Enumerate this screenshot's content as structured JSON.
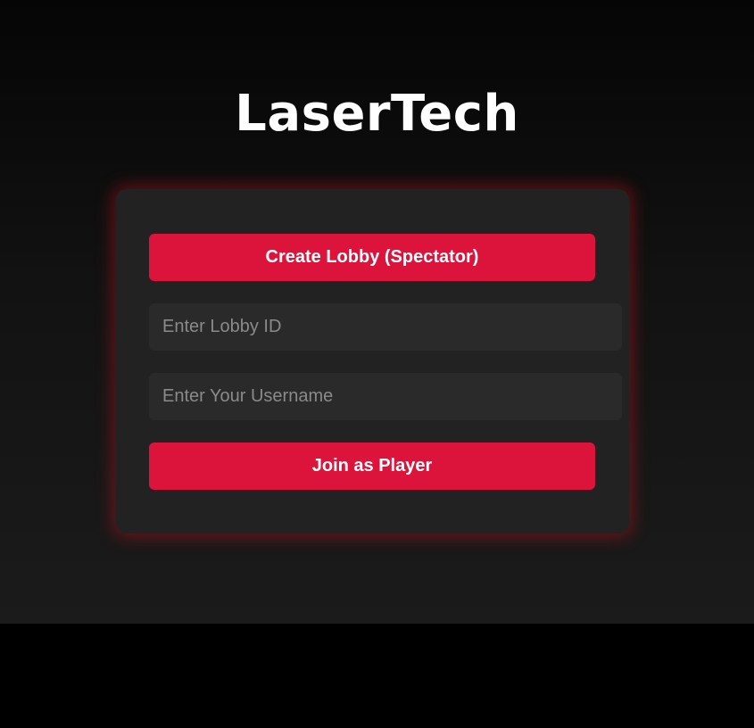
{
  "app": {
    "title": "LaserTech"
  },
  "lobby_form": {
    "create_button_label": "Create Lobby (Spectator)",
    "lobby_id_placeholder": "Enter Lobby ID",
    "lobby_id_value": "",
    "username_placeholder": "Enter Your Username",
    "username_value": "",
    "join_button_label": "Join as Player"
  },
  "colors": {
    "accent": "#dc143c",
    "card_background": "#222222",
    "input_background": "#2a2a2a",
    "page_background": "#121212",
    "glow": "#c8141e"
  }
}
